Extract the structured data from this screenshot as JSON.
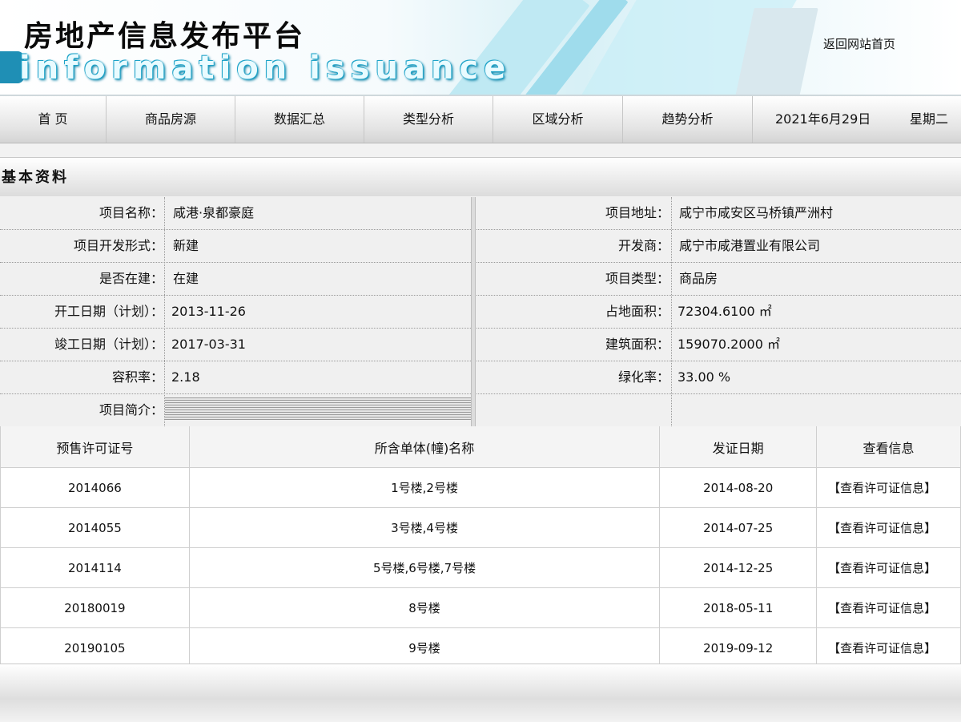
{
  "header": {
    "title_cn": "房地产信息发布平台",
    "title_en": "information issuance",
    "back_home": "返回网站首页"
  },
  "nav": {
    "items": [
      "首 页",
      "商品房源",
      "数据汇总",
      "类型分析",
      "区域分析",
      "趋势分析"
    ],
    "date": "2021年6月29日",
    "weekday": "星期二"
  },
  "section": {
    "title": "基本资料"
  },
  "info": {
    "left": [
      {
        "label": "项目名称：",
        "value": "咸港·泉都豪庭"
      },
      {
        "label": "项目开发形式：",
        "value": "新建"
      },
      {
        "label": "是否在建：",
        "value": "在建"
      },
      {
        "label": "开工日期（计划）：",
        "value": "2013-11-26"
      },
      {
        "label": "竣工日期（计划）：",
        "value": "2017-03-31"
      },
      {
        "label": "容积率：",
        "value": "2.18"
      },
      {
        "label": "项目简介：",
        "value": ""
      }
    ],
    "right": [
      {
        "label": "项目地址：",
        "value": "咸宁市咸安区马桥镇严洲村"
      },
      {
        "label": "开发商：",
        "value": "咸宁市咸港置业有限公司"
      },
      {
        "label": "项目类型：",
        "value": "商品房"
      },
      {
        "label": "占地面积：",
        "value": "72304.6100 ㎡"
      },
      {
        "label": "建筑面积：",
        "value": "159070.2000 ㎡"
      },
      {
        "label": "绿化率：",
        "value": "33.00 %"
      }
    ]
  },
  "permits": {
    "headers": [
      "预售许可证号",
      "所含单体(幢)名称",
      "发证日期",
      "查看信息"
    ],
    "rows": [
      {
        "no": "2014066",
        "units": "1号楼,2号楼",
        "date": "2014-08-20",
        "link": "【查看许可证信息】"
      },
      {
        "no": "2014055",
        "units": "3号楼,4号楼",
        "date": "2014-07-25",
        "link": "【查看许可证信息】"
      },
      {
        "no": "2014114",
        "units": "5号楼,6号楼,7号楼",
        "date": "2014-12-25",
        "link": "【查看许可证信息】"
      },
      {
        "no": "20180019",
        "units": "8号楼",
        "date": "2018-05-11",
        "link": "【查看许可证信息】"
      },
      {
        "no": "20190105",
        "units": "9号楼",
        "date": "2019-09-12",
        "link": "【查看许可证信息】"
      }
    ]
  }
}
